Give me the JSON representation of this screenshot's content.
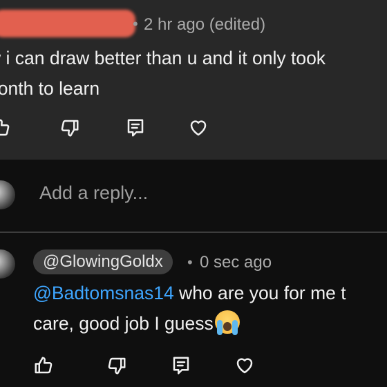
{
  "top_comment": {
    "time": "2 hr ago (edited)",
    "text_line1": "w i can draw better than u and it only took",
    "text_line2": "nonth to learn",
    "actions": {
      "like_icon": "thumbs-up-icon",
      "dislike_icon": "thumbs-down-icon",
      "reply_icon": "reply-icon",
      "heart_icon": "heart-icon"
    }
  },
  "reply_box": {
    "placeholder": "Add a reply..."
  },
  "reply": {
    "author_handle": "@GlowingGoldx",
    "time": "0 sec ago",
    "mention": "@Badtomsnas14",
    "text_line1_rest": " who are you for me t",
    "text_line2": "care, good job I guess",
    "emoji": "loudly-crying-face"
  },
  "colors": {
    "background": "#0f0f0f",
    "highlight_background": "#282828",
    "mention": "#3ea6ff",
    "redaction": "#e2604f"
  }
}
